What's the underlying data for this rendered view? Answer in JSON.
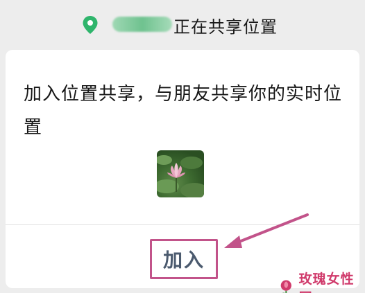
{
  "status": {
    "sharing_text": "正在共享位置"
  },
  "card": {
    "invite_text": "加入位置共享，与朋友共享你的实时位置",
    "join_label": "加入"
  },
  "watermark": {
    "text": "玫瑰女性网"
  },
  "colors": {
    "pin": "#2fb56c",
    "highlight": "#c2538a",
    "join_text": "#4b5a6e"
  },
  "icons": [
    "location-pin-icon",
    "arrow-icon",
    "rose-logo-icon"
  ]
}
